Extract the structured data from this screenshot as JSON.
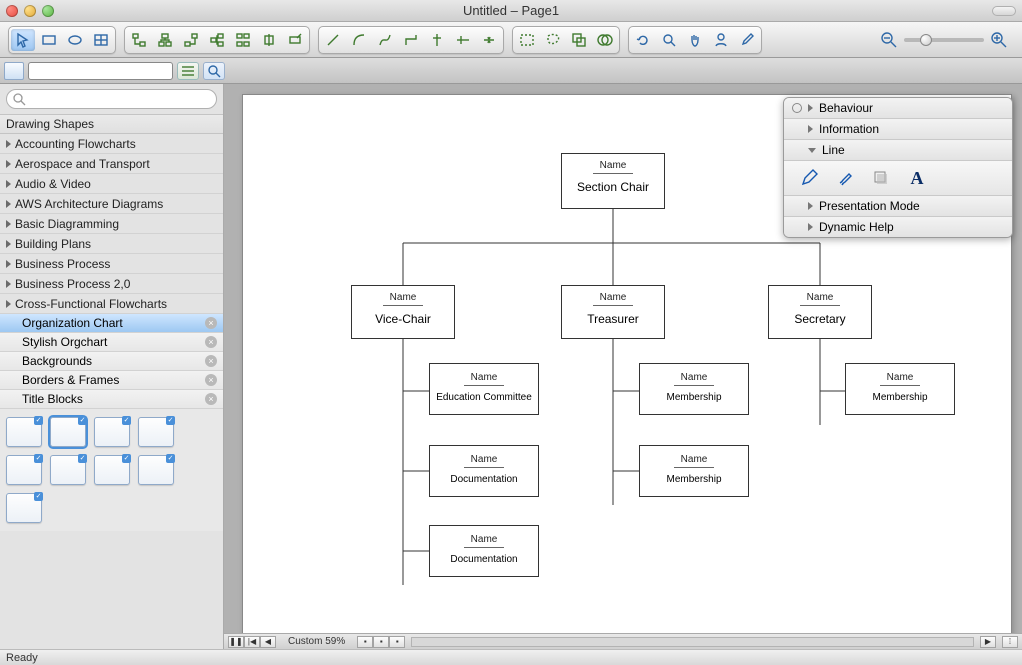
{
  "window": {
    "title": "Untitled – Page1"
  },
  "sidebar": {
    "search_placeholder": "",
    "heading": "Drawing Shapes",
    "categories": [
      "Accounting Flowcharts",
      "Aerospace and Transport",
      "Audio & Video",
      "AWS Architecture Diagrams",
      "Basic Diagramming",
      "Building Plans",
      "Business Process",
      "Business Process 2,0",
      "Cross-Functional Flowcharts"
    ],
    "sub_items": [
      {
        "label": "Organization Chart",
        "selected": true
      },
      {
        "label": "Stylish Orgchart",
        "selected": false
      },
      {
        "label": "Backgrounds",
        "selected": false
      },
      {
        "label": "Borders & Frames",
        "selected": false
      },
      {
        "label": "Title Blocks",
        "selected": false
      }
    ]
  },
  "org": {
    "name_label": "Name",
    "root": "Section Chair",
    "level2": [
      "Vice-Chair",
      "Treasurer",
      "Secretary"
    ],
    "vc_children": [
      "Education Committee",
      "Documentation",
      "Documentation"
    ],
    "tr_children": [
      "Membership",
      "Membership"
    ],
    "sec_children": [
      "Membership"
    ]
  },
  "inspector": {
    "items": [
      "Behaviour",
      "Information",
      "Line",
      "Presentation Mode",
      "Dynamic Help"
    ],
    "text_tool_label": "A"
  },
  "bottom": {
    "zoom_label": "Custom 59%"
  },
  "status": {
    "text": "Ready"
  }
}
